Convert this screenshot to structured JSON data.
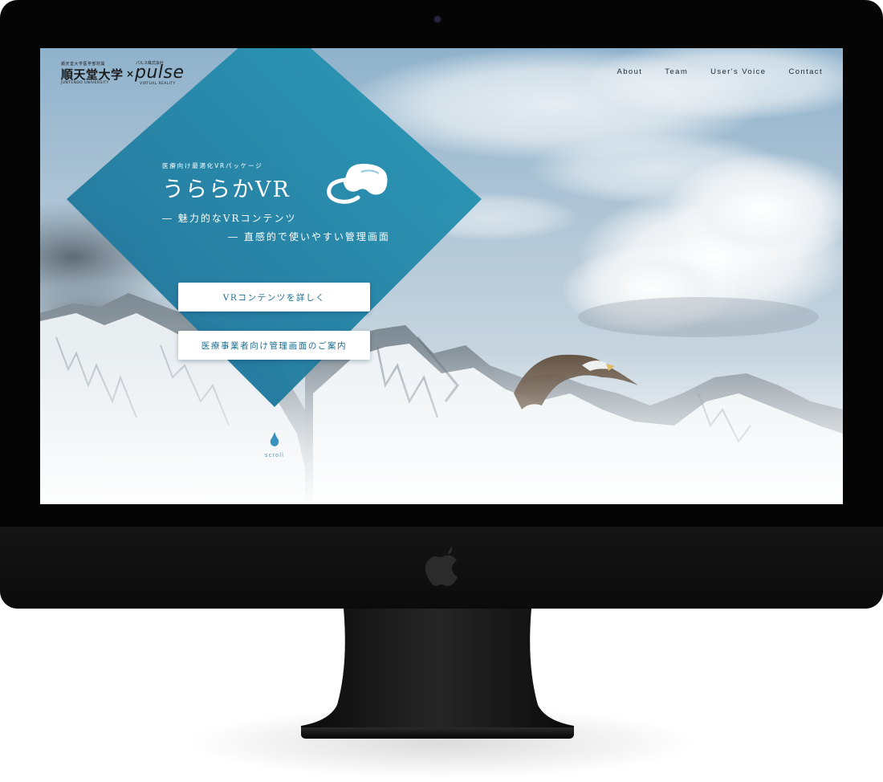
{
  "logo": {
    "juntendo_small": "順天堂大学医学部附属",
    "juntendo": "順天堂大学",
    "juntendo_en": "JUNTENDO UNIVERSITY",
    "times": "×",
    "pulse_small": "パルス株式会社",
    "pulse": "pulse",
    "pulse_tagline": "VIRTUAL REALITY"
  },
  "nav": {
    "items": [
      {
        "label": "About"
      },
      {
        "label": "Team"
      },
      {
        "label": "User's Voice"
      },
      {
        "label": "Contact"
      }
    ]
  },
  "hero": {
    "eyebrow": "医療向け最適化VRパッケージ",
    "title": "うららかVR",
    "feature_1": "―  魅力的なVRコンテンツ",
    "feature_2": "―  直感的で使いやすい管理画面"
  },
  "buttons": {
    "vr_contents": "VRコンテンツを詳しく",
    "admin_guide": "医療事業者向け管理画面のご案内"
  },
  "scroll": {
    "label": "scroll"
  },
  "colors": {
    "diamond_start": "#2a94b8",
    "diamond_end": "#1f6f96",
    "accent_text": "#1f6d92",
    "bezel": "#050505"
  },
  "icons": {
    "headset": "vr-headset-icon",
    "scroll": "water-drop-icon",
    "apple": "apple-logo-icon"
  }
}
